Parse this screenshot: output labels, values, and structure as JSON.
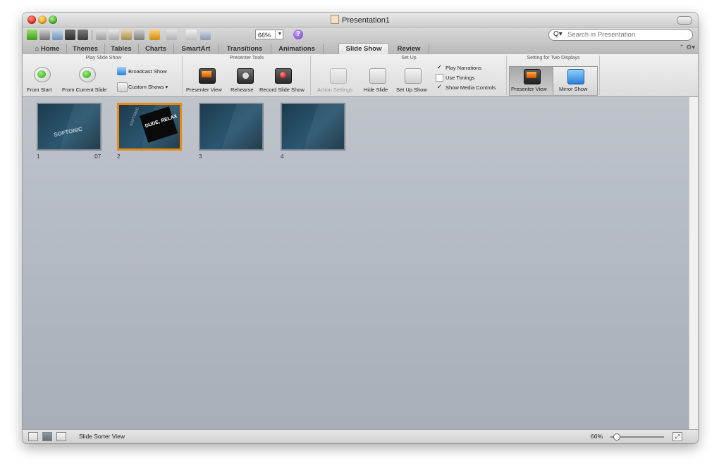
{
  "window": {
    "title": "Presentation1"
  },
  "toolbar": {
    "zoom_value": "66%",
    "search_placeholder": "Search in Presentation",
    "icons": [
      "new-icon",
      "templates-icon",
      "open-icon",
      "save-icon",
      "print-icon",
      "cut-icon",
      "copy-icon",
      "paste-icon",
      "format-icon",
      "undo-icon",
      "redo-icon",
      "insert-slide-icon",
      "media-icon",
      "help-icon"
    ]
  },
  "tabs": [
    {
      "label": "Home"
    },
    {
      "label": "Themes"
    },
    {
      "label": "Tables"
    },
    {
      "label": "Charts"
    },
    {
      "label": "SmartArt"
    },
    {
      "label": "Transitions"
    },
    {
      "label": "Animations"
    },
    {
      "label": "Slide Show",
      "active": true
    },
    {
      "label": "Review"
    }
  ],
  "ribbon": {
    "play_group_title": "Play Slide Show",
    "from_start": "From Start",
    "from_current": "From Current Slide",
    "broadcast": "Broadcast Show",
    "custom_shows": "Custom Shows",
    "presenter_group_title": "Presenter Tools",
    "presenter_view": "Presenter View",
    "rehearse": "Rehearse",
    "record": "Record Slide Show",
    "setup_group_title": "Set Up",
    "action_settings": "Action Settings",
    "hide_slide": "Hide Slide",
    "setup_show": "Set Up Show",
    "play_narrations": "Play Narrations",
    "use_timings": "Use Timings",
    "show_media_controls": "Show Media Controls",
    "two_displays_title": "Setting for Two Displays",
    "presenter_view2": "Presenter View",
    "mirror_show": "Mirror Show",
    "check_mark": "✓"
  },
  "slides": [
    {
      "number": "1",
      "time": ":07",
      "text": "SOFTONIC",
      "selected": false
    },
    {
      "number": "2",
      "time": "",
      "text": "DUDE, RELAX",
      "side_text": "SOFTONIC",
      "selected": true
    },
    {
      "number": "3",
      "time": "",
      "text": "",
      "selected": false
    },
    {
      "number": "4",
      "time": "",
      "text": "",
      "selected": false
    }
  ],
  "status": {
    "view_label": "Slide Sorter View",
    "zoom": "66%"
  }
}
